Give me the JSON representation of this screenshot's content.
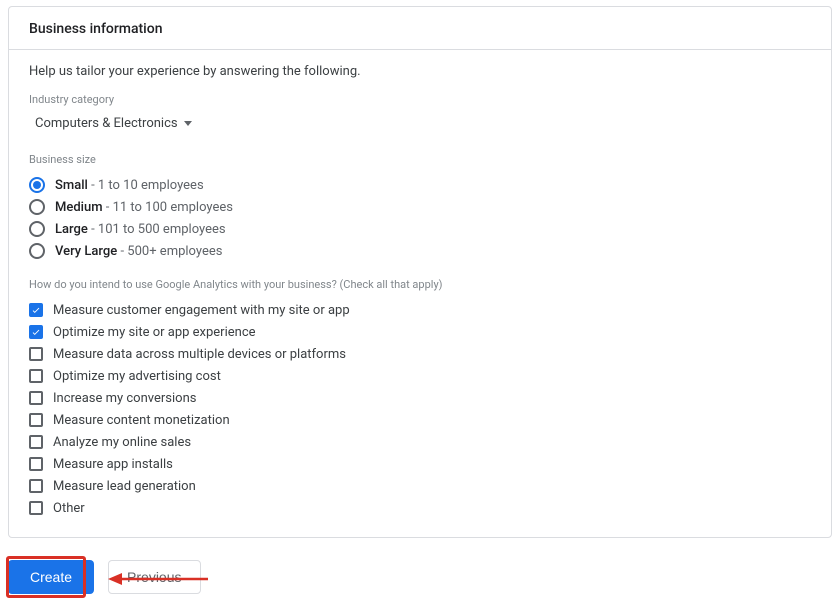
{
  "header": {
    "title": "Business information"
  },
  "help_text": "Help us tailor your experience by answering the following.",
  "industry": {
    "label": "Industry category",
    "selected": "Computers & Electronics"
  },
  "business_size": {
    "label": "Business size",
    "options": [
      {
        "bold": "Small",
        "rest": " - 1 to 10 employees",
        "selected": true
      },
      {
        "bold": "Medium",
        "rest": " - 11 to 100 employees",
        "selected": false
      },
      {
        "bold": "Large",
        "rest": " - 101 to 500 employees",
        "selected": false
      },
      {
        "bold": "Very Large",
        "rest": " - 500+ employees",
        "selected": false
      }
    ]
  },
  "usage": {
    "label": "How do you intend to use Google Analytics with your business? (Check all that apply)",
    "options": [
      {
        "label": "Measure customer engagement with my site or app",
        "checked": true
      },
      {
        "label": "Optimize my site or app experience",
        "checked": true
      },
      {
        "label": "Measure data across multiple devices or platforms",
        "checked": false
      },
      {
        "label": "Optimize my advertising cost",
        "checked": false
      },
      {
        "label": "Increase my conversions",
        "checked": false
      },
      {
        "label": "Measure content monetization",
        "checked": false
      },
      {
        "label": "Analyze my online sales",
        "checked": false
      },
      {
        "label": "Measure app installs",
        "checked": false
      },
      {
        "label": "Measure lead generation",
        "checked": false
      },
      {
        "label": "Other",
        "checked": false
      }
    ]
  },
  "buttons": {
    "create": "Create",
    "previous": "Previous"
  },
  "annotation": {
    "highlight_color": "#d93025"
  }
}
